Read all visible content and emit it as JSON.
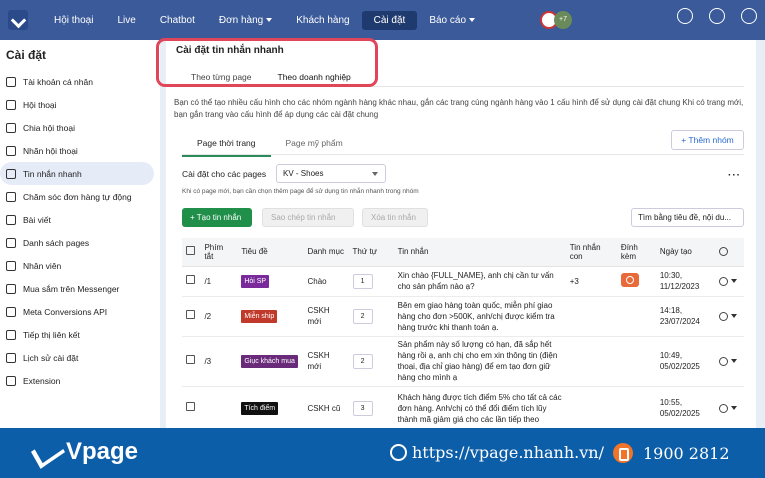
{
  "nav": {
    "items": [
      "Hội thoại",
      "Live",
      "Chatbot",
      "Đơn hàng",
      "Khách hàng",
      "Cài đặt",
      "Báo cáo"
    ],
    "active": "Cài đặt",
    "avatar_badge": "+7"
  },
  "sidebar": {
    "title": "Cài đặt",
    "items": [
      {
        "label": "Tài khoản cá nhân",
        "icon": "user-icon"
      },
      {
        "label": "Hội thoại",
        "icon": "chat-icon"
      },
      {
        "label": "Chia hội thoại",
        "icon": "share-icon"
      },
      {
        "label": "Nhãn hội thoại",
        "icon": "tag-icon"
      },
      {
        "label": "Tin nhắn nhanh",
        "icon": "message-icon"
      },
      {
        "label": "Chăm sóc đơn hàng tự động",
        "icon": "cart-icon"
      },
      {
        "label": "Bài viết",
        "icon": "post-icon"
      },
      {
        "label": "Danh sách pages",
        "icon": "list-icon"
      },
      {
        "label": "Nhân viên",
        "icon": "staff-icon"
      },
      {
        "label": "Mua sắm trên Messenger",
        "icon": "messenger-icon"
      },
      {
        "label": "Meta Conversions API",
        "icon": "meta-icon"
      },
      {
        "label": "Tiếp thị liên kết",
        "icon": "link-icon"
      },
      {
        "label": "Lịch sử cài đặt",
        "icon": "history-icon"
      },
      {
        "label": "Extension",
        "icon": "extension-icon"
      }
    ],
    "active_index": 4
  },
  "main": {
    "title": "Cài đặt tin nhắn nhanh",
    "tabs": [
      "Theo từng page",
      "Theo doanh nghiệp"
    ],
    "description": "Bạn có thể tạo nhiều cấu hình cho các nhóm ngành hàng khác nhau, gắn các trang cùng ngành hàng vào 1 cấu hình để sử dụng cài đặt chung Khi có trang mới, bạn gắn trang vào cấu hình để áp dụng các cài đặt chung",
    "sub_tabs": [
      "Page thời trang",
      "Page mỹ phẩm"
    ],
    "add_group": "+ Thêm nhóm",
    "config_label": "Cài đặt cho các pages",
    "config_value": "KV - Shoes",
    "hint": "Khi có page mới, bạn cần chọn thêm page để sử dụng tin nhắn nhanh trong nhóm",
    "create_btn": "+ Tạo tin nhắn",
    "copy_btn": "Sao chép tin nhắn",
    "delete_btn": "Xóa tin nhắn",
    "search_placeholder": "Tìm bằng tiêu đề, nội du..."
  },
  "table": {
    "headers": [
      "Phím tắt",
      "Tiêu đề",
      "Danh mục",
      "Thứ tự",
      "Tin nhắn",
      "Tin nhắn con",
      "Đính kèm",
      "Ngày tạo"
    ],
    "rows": [
      {
        "shortcut": "/1",
        "title": "Hỏi SP",
        "tag_color": "#7a2a9a",
        "category": "Chào",
        "order": "1",
        "message": "Xin chào {FULL_NAME}, anh chị cần tư vấn cho sản phẩm nào ạ?",
        "sub": "+3",
        "attach": true,
        "date": "10:30, 11/12/2023"
      },
      {
        "shortcut": "/2",
        "title": "Miễn ship",
        "tag_color": "#c0392b",
        "category": "CSKH mới",
        "order": "2",
        "message": "Bên em giao hàng toàn quốc, miễn phí giao hàng cho đơn >500K, anh/chị được kiểm tra hàng trước khi thanh toán ạ.",
        "sub": "",
        "attach": false,
        "date": "14:18, 23/07/2024"
      },
      {
        "shortcut": "/3",
        "title": "Giục khách mua",
        "tag_color": "#6a2a7a",
        "category": "CSKH mới",
        "order": "2",
        "message": "Sản phẩm này số lượng có hạn, đã sắp hết hàng rồi ạ, anh chị cho em xin thông tin (điện thoại, địa chỉ giao hàng) để em tạo đơn giữ hàng cho mình ạ",
        "sub": "",
        "attach": false,
        "date": "10:49, 05/02/2025"
      },
      {
        "shortcut": "",
        "title": "Tích điểm",
        "tag_color": "#111111",
        "category": "CSKH cũ",
        "order": "3",
        "message": "Khách hàng được tích điểm 5% cho tất cả các đơn hàng. Anh/chị có thể đổi điểm tích lũy thành mã giảm giá cho các lần tiếp theo",
        "sub": "",
        "attach": false,
        "date": "10:55, 05/02/2025"
      }
    ]
  },
  "footer": {
    "brand": "Vpage",
    "website": "https://vpage.nhanh.vn/",
    "phone": "1900 2812"
  },
  "colors": {
    "nav": "#3b5a9a",
    "primary": "#1f8f4a",
    "footer": "#0d5ea8",
    "highlight": "#e0455a"
  }
}
